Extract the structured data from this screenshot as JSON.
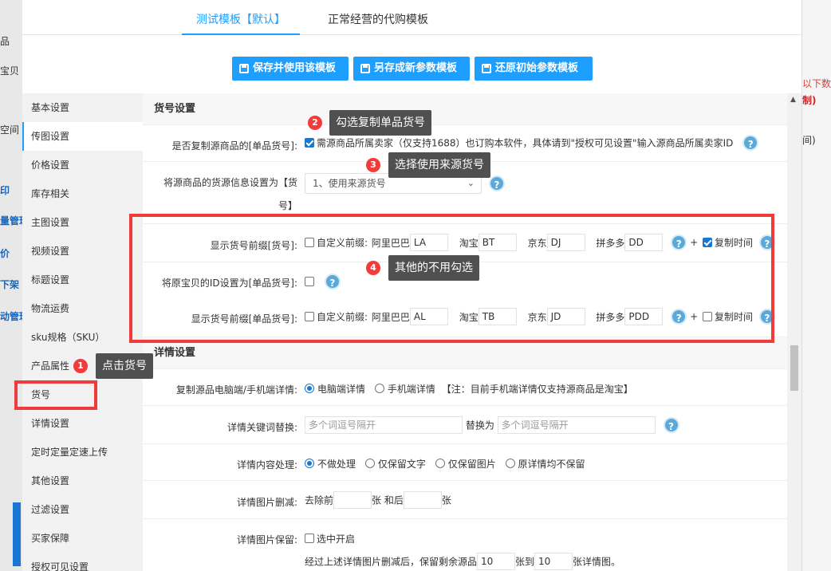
{
  "background": {
    "left_fragments": [
      "品",
      "宝贝",
      "空间",
      "印",
      "量管理",
      "价",
      "下架",
      "动管理"
    ],
    "right_fragments": [
      "以下数",
      "制)",
      "间)"
    ]
  },
  "tabs": [
    {
      "label": "测试模板【默认】",
      "active": true
    },
    {
      "label": "正常经营的代购模板",
      "active": false
    }
  ],
  "buttons": {
    "save_use": "保存并使用该模板",
    "save_new": "另存成新参数模板",
    "restore": "还原初始参数模板"
  },
  "menu": [
    "基本设置",
    "传图设置",
    "价格设置",
    "库存相关",
    "主图设置",
    "视频设置",
    "标题设置",
    "物流运费",
    "sku规格（SKU）",
    "产品属性",
    "货号",
    "详情设置",
    "定时定量定速上传",
    "其他设置",
    "过滤设置",
    "买家保障",
    "授权可见设置"
  ],
  "huohao": {
    "section_title": "货号设置",
    "copy_label": "是否复制源商品的[单品货号]:",
    "copy_text": "需源商品所属卖家（仅支持1688）也订购本软件，具体请到\"授权可见设置\"输入源商品所属卖家ID",
    "source_label_1": "将源商品的货源信息设置为【货",
    "source_label_2": "号】",
    "source_select": "1、使用来源货号",
    "prefix_label": "显示货号前缀[货号]:",
    "custom_prefix": "自定义前缀:",
    "alibaba": "阿里巴巴",
    "taobao": "淘宝",
    "jd": "京东",
    "pdd": "拼多多",
    "prefix1": {
      "ali": "LA",
      "tb": "BT",
      "jd": "DJ",
      "pdd": "DD"
    },
    "plus": "+",
    "copy_time": "复制时间",
    "id_label": "将原宝贝的ID设置为[单品货号]:",
    "prefix2_label": "显示货号前缀[单品货号]:",
    "prefix2": {
      "ali": "AL",
      "tb": "TB",
      "jd": "JD",
      "pdd": "PDD"
    }
  },
  "detail": {
    "section_title": "详情设置",
    "copy_label": "复制源品电脑端/手机端详情:",
    "pc": "电脑端详情",
    "mobile": "手机端详情",
    "note": "【注：目前手机端详情仅支持源商品是淘宝】",
    "kw_label": "详情关键词替换:",
    "kw_placeholder": "多个词逗号隔开",
    "replace_with": "替换为",
    "content_label": "详情内容处理:",
    "opt_none": "不做处理",
    "opt_text": "仅保留文字",
    "opt_img": "仅保留图片",
    "opt_none_keep": "原详情均不保留",
    "img_del_label": "详情图片删减:",
    "remove_front": "去除前",
    "zhang_after": "张 和后",
    "zhang": "张",
    "img_keep_label": "详情图片保留:",
    "select_on": "选中开启",
    "keep_text_1": "经过上述详情图片删减后，保留剩余源品",
    "keep_val_1": "10",
    "keep_text_2": "张到",
    "keep_val_2": "10",
    "keep_text_3": "张详情图。"
  },
  "annotations": {
    "b1": "1",
    "t1": "点击货号",
    "b2": "2",
    "t2": "勾选复制单品货号",
    "b3": "3",
    "t3": "选择使用来源货号",
    "b4": "4",
    "t4": "其他的不用勾选"
  },
  "help_glyph": "?",
  "scroll_up_glyph": "▲",
  "select_arrow_glyph": "⌄",
  "colors": {
    "primary": "#1e9fff",
    "annotation": "#f03b3b",
    "tooltip": "#505050"
  }
}
